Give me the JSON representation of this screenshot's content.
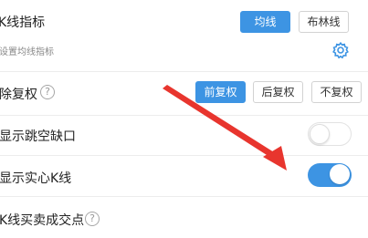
{
  "kline_indicator": {
    "title": "K线指标",
    "options": [
      "均线",
      "布林线"
    ],
    "selected": "均线",
    "subtitle": "设置均线指标",
    "settings_icon": "gear-icon"
  },
  "adjustment": {
    "title": "除复权",
    "help_icon": "question-circle-icon",
    "help_glyph": "?",
    "options": [
      "前复权",
      "后复权",
      "不复权"
    ],
    "selected": "前复权"
  },
  "show_gap": {
    "title": "显示跳空缺口",
    "enabled": false
  },
  "show_solid_kline": {
    "title": "显示实心K线",
    "enabled": true
  },
  "kline_cross": {
    "title": "K线买卖成交点",
    "help_icon": "question-circle-icon",
    "help_glyph": "?"
  },
  "colors": {
    "accent": "#3d94e3",
    "annotation_arrow": "#e8352e"
  }
}
